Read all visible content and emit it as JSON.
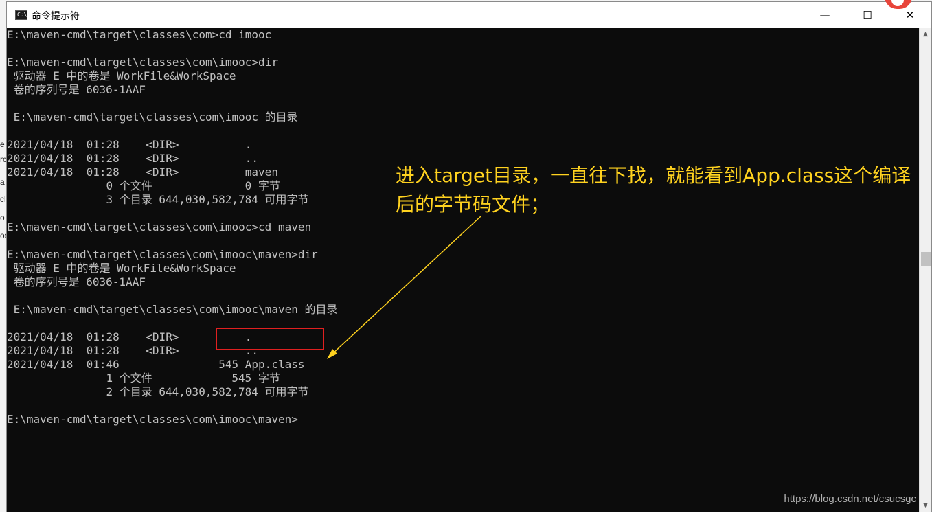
{
  "window": {
    "title": "命令提示符",
    "icon_label": "C:\\",
    "controls": {
      "minimize": "—",
      "maximize": "☐",
      "close": "✕"
    }
  },
  "terminal": {
    "lines": [
      "E:\\maven-cmd\\target\\classes\\com>cd imooc",
      "",
      "E:\\maven-cmd\\target\\classes\\com\\imooc>dir",
      " 驱动器 E 中的卷是 WorkFile&WorkSpace",
      " 卷的序列号是 6036-1AAF",
      "",
      " E:\\maven-cmd\\target\\classes\\com\\imooc 的目录",
      "",
      "2021/04/18  01:28    <DIR>          .",
      "2021/04/18  01:28    <DIR>          ..",
      "2021/04/18  01:28    <DIR>          maven",
      "               0 个文件              0 字节",
      "               3 个目录 644,030,582,784 可用字节",
      "",
      "E:\\maven-cmd\\target\\classes\\com\\imooc>cd maven",
      "",
      "E:\\maven-cmd\\target\\classes\\com\\imooc\\maven>dir",
      " 驱动器 E 中的卷是 WorkFile&WorkSpace",
      " 卷的序列号是 6036-1AAF",
      "",
      " E:\\maven-cmd\\target\\classes\\com\\imooc\\maven 的目录",
      "",
      "2021/04/18  01:28    <DIR>          .",
      "2021/04/18  01:28    <DIR>          ..",
      "2021/04/18  01:46               545 App.class",
      "               1 个文件            545 字节",
      "               2 个目录 644,030,582,784 可用字节",
      "",
      "E:\\maven-cmd\\target\\classes\\com\\imooc\\maven>"
    ]
  },
  "annotation": {
    "text": "进入target目录，一直往下找，就能看到App.class这个编译后的字节码文件；"
  },
  "watermark": "https://blog.csdn.net/csucsgc",
  "background_fragments": [
    "e",
    "ro",
    "a",
    "cl",
    "o",
    "oc"
  ],
  "colors": {
    "annotation": "#ffd21f",
    "highlight": "#e02020",
    "terminal_text": "#c0c0c0",
    "terminal_bg": "#0c0c0c"
  }
}
